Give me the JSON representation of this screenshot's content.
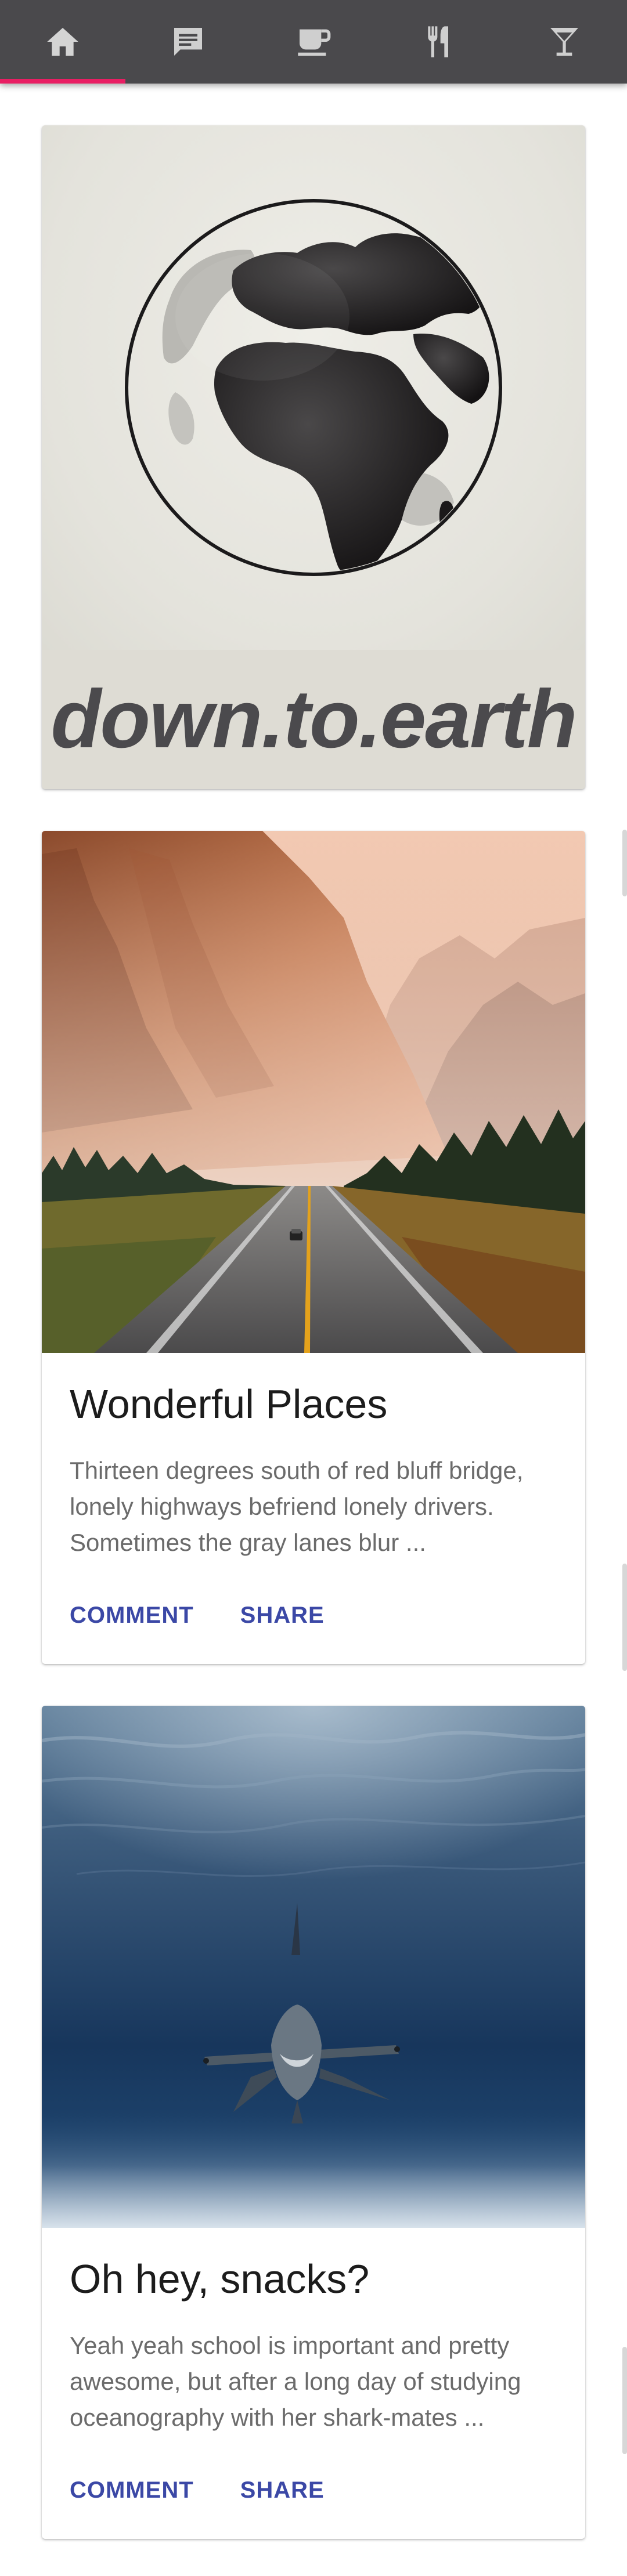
{
  "tabs": [
    {
      "icon": "home-icon",
      "active": true
    },
    {
      "icon": "chat-icon",
      "active": false
    },
    {
      "icon": "coffee-icon",
      "active": false
    },
    {
      "icon": "restaurant-icon",
      "active": false
    },
    {
      "icon": "cocktail-icon",
      "active": false
    }
  ],
  "colors": {
    "tabbar": "#4a494c",
    "tab_icon": "#cfcfcf",
    "tab_indicator": "#e91e63",
    "action_text": "#3b48a6"
  },
  "hero": {
    "brand": "down.to.earth",
    "image": "globe-illustration"
  },
  "cards": [
    {
      "image": "mountain-highway-photo",
      "title": "Wonderful Places",
      "text": "Thirteen degrees south of red bluff bridge, lonely highways befriend lonely drivers. Sometimes the gray lanes blur ...",
      "actions": [
        "COMMENT",
        "SHARE"
      ]
    },
    {
      "image": "hammerhead-shark-photo",
      "title": "Oh hey, snacks?",
      "text": "Yeah yeah school is important and pretty awesome, but after a long day of studying oceanography with her shark-mates ...",
      "actions": [
        "COMMENT",
        "SHARE"
      ]
    }
  ]
}
